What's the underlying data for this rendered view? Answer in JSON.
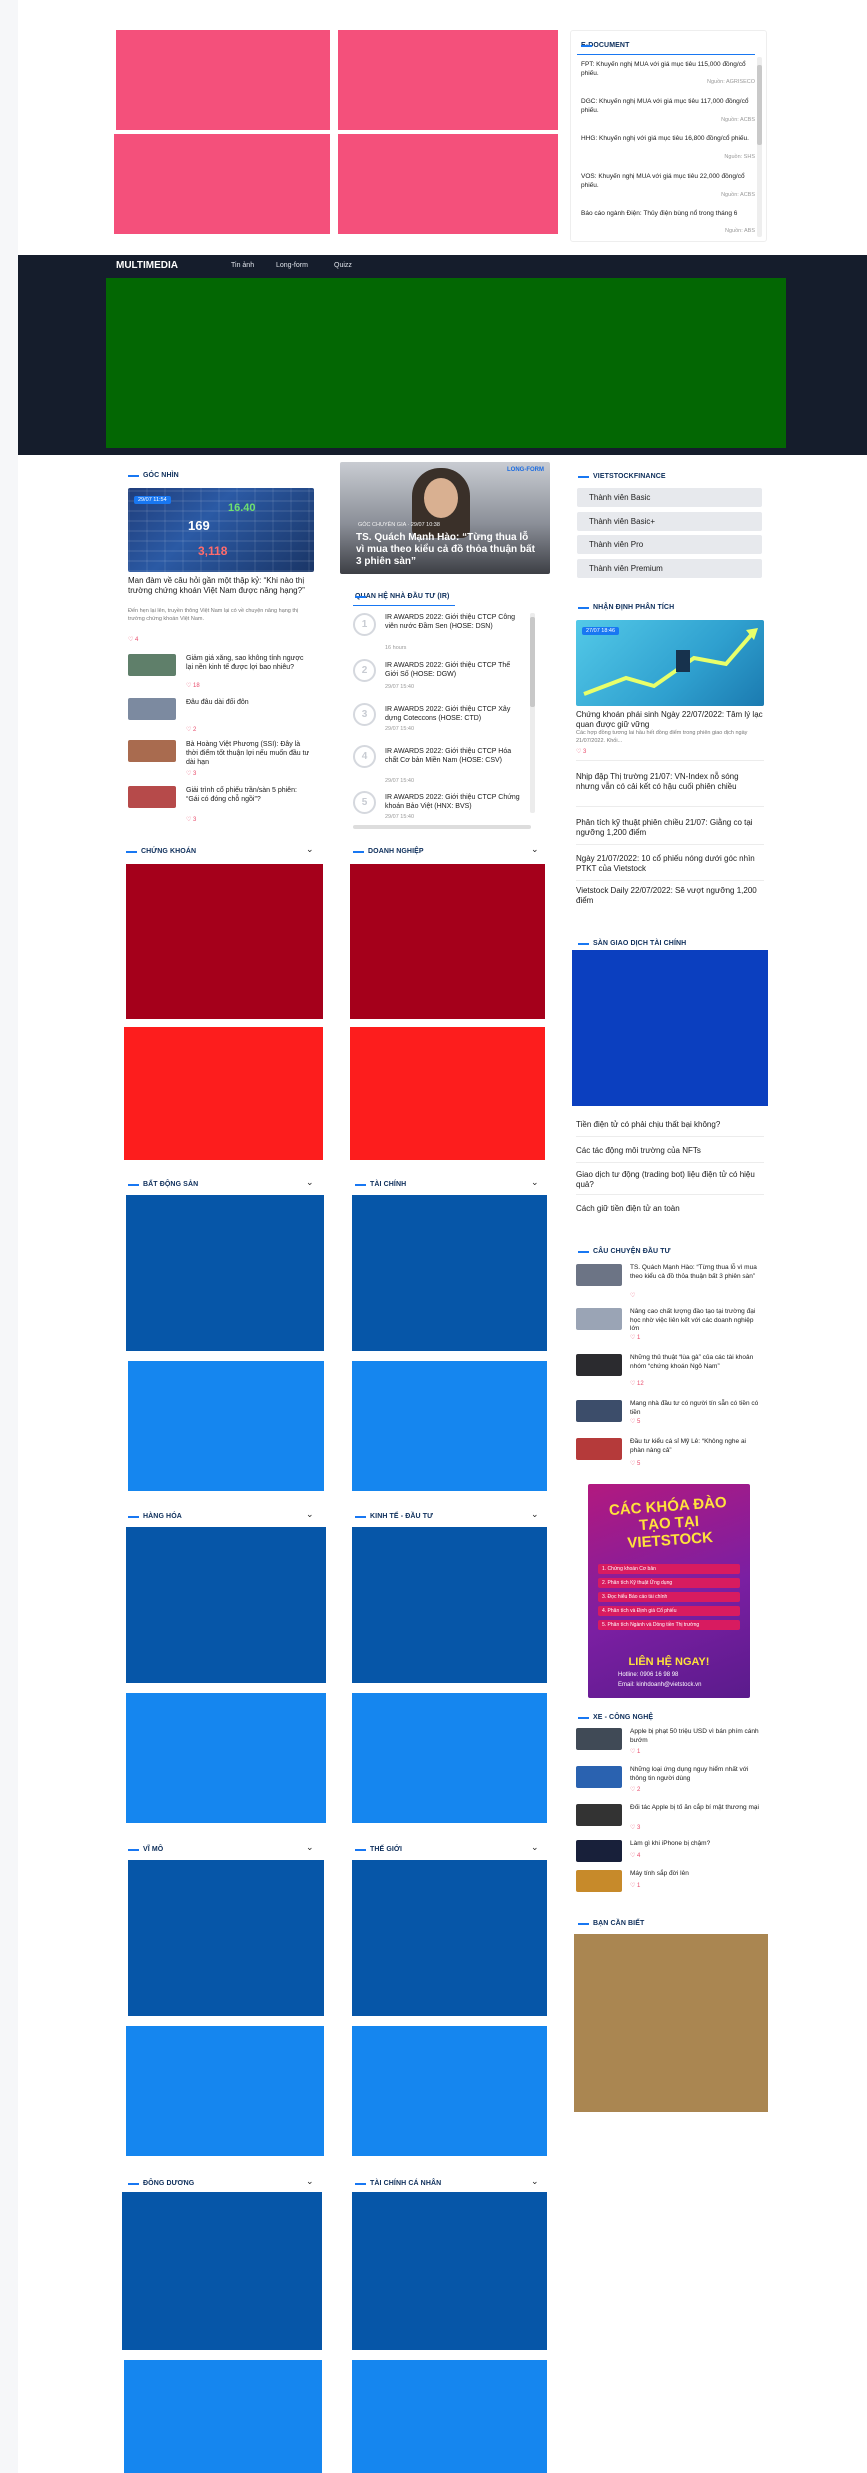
{
  "colors": {
    "pink": "#f4507b",
    "navy": "#151d2c",
    "green": "#036703",
    "crimson": "#a5001b",
    "red": "#fd1d1d",
    "blue_dark": "#0656a8",
    "blue_light": "#1586ef",
    "blue_royal": "#0b3fbf",
    "tan": "#aa8651",
    "accent": "#1877f2"
  },
  "edocument": {
    "title": "E-DOCUMENT",
    "items": [
      {
        "text": "FPT: Khuyến nghị MUA với giá mục tiêu 115,000 đồng/cổ phiếu.",
        "source": "Nguồn: AGRISECO"
      },
      {
        "text": "DGC: Khuyến nghị MUA với giá mục tiêu 117,000 đồng/cổ phiếu.",
        "source": "Nguồn: ACBS"
      },
      {
        "text": "HHG: Khuyến nghị với giá mục tiêu 16,800 đồng/cổ phiếu.",
        "source": "Nguồn: SHS"
      },
      {
        "text": "VOS: Khuyến nghị MUA với giá mục tiêu 22,000 đồng/cổ phiếu.",
        "source": "Nguồn: ACBS"
      },
      {
        "text": "Báo cáo ngành Điện: Thủy điện bùng nổ trong tháng 6",
        "source": "Nguồn: ABS"
      }
    ]
  },
  "multimedia": {
    "title": "MULTIMEDIA",
    "tabs": [
      "Tin ảnh",
      "Long-form",
      "Quizz"
    ]
  },
  "goc_nhin": {
    "title": "GÓC NHÌN",
    "badge": "29/07 11:54",
    "main_title": "Man đàm về câu hỏi gần một thập kỷ: “Khi nào thị trường chứng khoán Việt Nam được nâng hạng?”",
    "main_desc": "Đến hẹn lại lên, truyền thông Việt Nam lại có về chuyện nâng hạng thị trường chứng khoán Việt Nam.",
    "main_count": "4",
    "items": [
      {
        "text": "Giảm giá xăng, sao không tính ngược lại nền kinh tế được lợi bao nhiêu?",
        "count": "18"
      },
      {
        "text": "Đâu đâu dài đối đôn",
        "count": "2"
      },
      {
        "text": "Bà Hoàng Việt Phương (SSI): Đây là thời điểm tốt thuận lợi nếu muốn đầu tư dài hạn",
        "count": "3"
      },
      {
        "text": "Giải trình cổ phiếu trần/sàn 5 phiên: “Gái có đóng chỗ ngồi”?",
        "count": "3"
      }
    ]
  },
  "feature": {
    "tag": "GÓC CHUYÊN GIA",
    "date": "29/07 10:38",
    "logo": "LONG-FORM",
    "title": "TS. Quách Mạnh Hào: “Từng thua lỗ vì mua theo kiểu cả đồ thỏa thuận bất 3 phiên sàn”"
  },
  "ir": {
    "title": "QUAN HỆ NHÀ ĐẦU TƯ (IR)",
    "items": [
      {
        "num": "1",
        "text": "IR AWARDS 2022: Giới thiệu CTCP Công viên nước Đầm Sen (HOSE: DSN)",
        "time": "16 hours"
      },
      {
        "num": "2",
        "text": "IR AWARDS 2022: Giới thiệu CTCP Thế Giới Số (HOSE: DGW)",
        "time": "29/07 15:40"
      },
      {
        "num": "3",
        "text": "IR AWARDS 2022: Giới thiệu CTCP Xây dựng Coteccons (HOSE: CTD)",
        "time": "29/07 15:40"
      },
      {
        "num": "4",
        "text": "IR AWARDS 2022: Giới thiệu CTCP Hóa chất Cơ bản Miền Nam (HOSE: CSV)",
        "time": "29/07 15:40"
      },
      {
        "num": "5",
        "text": "IR AWARDS 2022: Giới thiệu CTCP Chứng khoán Bảo Việt (HNX: BVS)",
        "time": "29/07 15:40"
      }
    ]
  },
  "vsf": {
    "title": "VIETSTOCKFINANCE",
    "buttons": [
      "Thành viên Basic",
      "Thành viên Basic+",
      "Thành viên Pro",
      "Thành viên Premium"
    ]
  },
  "nhan_dinh": {
    "title": "NHẬN ĐỊNH PHÂN TÍCH",
    "badge": "27/07 18:46",
    "main_title": "Chứng khoán phái sinh Ngày 22/07/2022: Tâm lý lạc quan được giữ vững",
    "main_desc": "Các hợp đồng tương lai hầu hết đồng điểm trong phiên giao dịch ngày 21/07/2022. Khối...",
    "main_count": "3",
    "items": [
      "Nhịp đập Thị trường 21/07: VN-Index nỗ sóng nhưng vẫn có cải kết có hậu cuối phiên chiều",
      "Phân tích kỹ thuật phiên chiều 21/07: Giằng co tại ngưỡng 1,200 điểm",
      "Ngày 21/07/2022: 10 cổ phiếu nóng dưới góc nhìn PTKT của Vietstock",
      "Vietstock Daily 22/07/2022: Sẽ vượt ngưỡng 1,200 điểm"
    ]
  },
  "san_gd": {
    "title": "SÀN GIAO DỊCH TÀI CHÍNH",
    "items": [
      "Tiền điện tử có phải chịu thất bại không?",
      "Các tác động môi trường của NFTs",
      "Giao dịch tư động (trading bot) liệu điện tử có hiệu quả?",
      "Cách giữ tiền điện tử an toàn"
    ]
  },
  "chuyen_dau_tu": {
    "title": "CÂU CHUYỆN ĐẦU TƯ",
    "items": [
      {
        "text": "TS. Quách Mạnh Hào: “Từng thua lỗ vì mua theo kiểu cả đồ thỏa thuận bất 3 phiên sàn”",
        "count": ""
      },
      {
        "text": "Nâng cao chất lượng đào tạo tại trường đại học nhờ việc liên kết với các doanh nghiệp lớn",
        "count": "1"
      },
      {
        "text": "Những thủ thuật “lùa gà” của các tài khoản nhóm “chứng khoán Ngô Nam”",
        "count": "12"
      },
      {
        "text": "Mang nhà đầu tư có người tín sẵn có tiền có tiền",
        "count": "5"
      },
      {
        "text": "Đầu tư kiểu cá sỉ Mỹ Lê: “Không nghe ai phàn nàng cả”",
        "count": "5"
      }
    ]
  },
  "ad": {
    "headline": "CÁC KHÓA ĐÀO TẠO TẠI VIETSTOCK",
    "courses": [
      "1. Chứng khoán Cơ bản",
      "2. Phân tích Kỹ thuật Ứng dụng",
      "3. Đọc hiểu Báo cáo tài chính",
      "4. Phân tích và Định giá Cổ phiếu",
      "5. Phân tích Ngành và Dòng tiền Thị trường"
    ],
    "cta": "LIÊN HỆ NGAY!",
    "hotline": "Hotline: 0906 16 98 98",
    "email": "Email: kinhdoanh@vietstock.vn"
  },
  "xe": {
    "title": "XE - CÔNG NGHỆ",
    "items": [
      {
        "text": "Apple bị phạt 50 triệu USD vì bán phím cánh bướm",
        "count": "1"
      },
      {
        "text": "Những loại ứng dụng nguy hiểm nhất với thông tin người dùng",
        "count": "2"
      },
      {
        "text": "Đối tác Apple bị tố ăn cắp bí mật thương mại",
        "count": "3"
      },
      {
        "text": "Làm gì khi iPhone bị chậm?",
        "count": "4"
      },
      {
        "text": "Máy tính sắp đời lên",
        "count": "1"
      }
    ]
  },
  "ban_can_biet": {
    "title": "BẠN CẦN BIẾT"
  },
  "sections": [
    "CHỨNG KHOÁN",
    "DOANH NGHIỆP",
    "BẤT ĐỘNG SẢN",
    "TÀI CHÍNH",
    "HÀNG HÓA",
    "KINH TẾ - ĐẦU TƯ",
    "VĨ MÔ",
    "THẾ GIỚI",
    "ĐÔNG DƯƠNG",
    "TÀI CHÍNH CÁ NHÂN"
  ]
}
